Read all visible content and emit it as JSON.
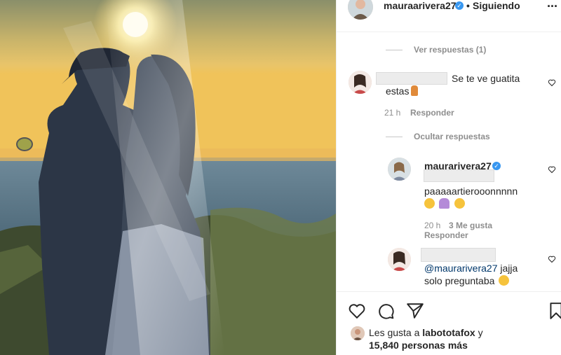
{
  "header": {
    "username": "mauraarivera27",
    "follow_status": "Siguiendo",
    "more": "..."
  },
  "thread": {
    "view_replies": "Ver respuestas (1)",
    "comment1": {
      "text_line1": "Se te ve guatita",
      "text_line2": "estas",
      "time": "21 h",
      "reply": "Responder"
    },
    "hide_replies": "Ocultar respuestas",
    "reply1": {
      "username": "maurarivera27",
      "text": "paaaaartierooonnnnn",
      "time": "20 h",
      "likes": "3 Me gusta",
      "reply": "Responder"
    },
    "reply2": {
      "mention": "@maurarivera27",
      "text_after": " jajja",
      "text_line2": "solo preguntaba"
    }
  },
  "likes": {
    "prefix": "Les gusta a ",
    "user": "labototafox",
    "suffix": " y",
    "count_line": "15,840 personas más"
  },
  "icons": [
    "heart-icon",
    "comment-icon",
    "share-icon",
    "bookmark-icon",
    "more-icon",
    "verified-icon"
  ],
  "colors": {
    "verified": "#3897f0",
    "text": "#262626",
    "muted": "#8e8e8e",
    "mention": "#00376b"
  }
}
